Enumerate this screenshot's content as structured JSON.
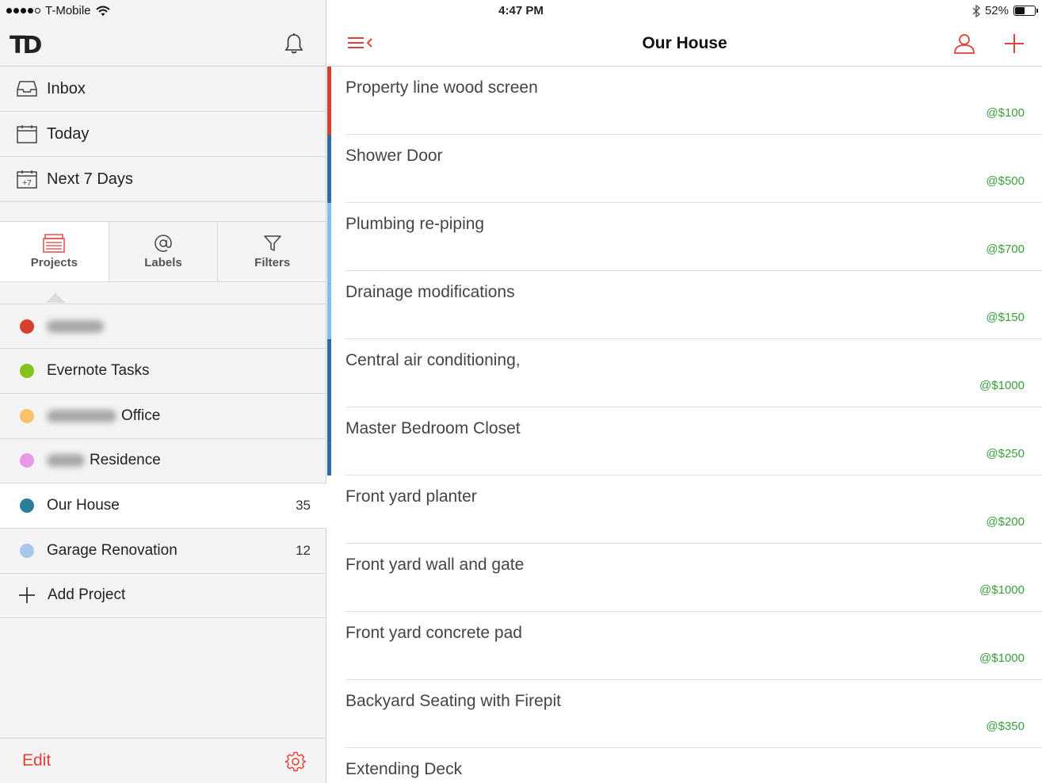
{
  "status_bar": {
    "carrier": "T-Mobile",
    "time": "4:47 PM",
    "battery": "52%",
    "battery_level": 0.52
  },
  "sidebar": {
    "logo": "TD",
    "nav": [
      {
        "label": "Inbox",
        "icon": "inbox-icon"
      },
      {
        "label": "Today",
        "icon": "calendar-icon"
      },
      {
        "label": "Next 7 Days",
        "icon": "calendar-plus7-icon",
        "icon_text": "+7"
      }
    ],
    "tabs": [
      {
        "label": "Projects",
        "icon": "projects-icon",
        "active": true
      },
      {
        "label": "Labels",
        "icon": "at-icon",
        "active": false
      },
      {
        "label": "Filters",
        "icon": "filter-icon",
        "active": false
      }
    ],
    "projects": [
      {
        "label": "",
        "color": "#d6402e",
        "count": "",
        "blurred": true
      },
      {
        "label": "Evernote Tasks",
        "color": "#84c31c",
        "count": ""
      },
      {
        "label": "Office",
        "color": "#fbc26e",
        "count": "",
        "blurred": true
      },
      {
        "label": "Residence",
        "color": "#e69ae6",
        "count": "",
        "blurred": true
      },
      {
        "label": "Our House",
        "color": "#2a7f97",
        "count": "35",
        "active": true
      },
      {
        "label": "Garage Renovation",
        "color": "#a9c7ea",
        "count": "12"
      }
    ],
    "add_project_label": "Add Project",
    "edit_label": "Edit"
  },
  "main": {
    "title": "Our House",
    "tasks": [
      {
        "name": "Property line wood screen",
        "label": "@$100",
        "color": "#d6402e"
      },
      {
        "name": "Shower Door",
        "label": "@$500",
        "color": "#2d6aa8"
      },
      {
        "name": "Plumbing re-piping",
        "label": "@$700",
        "color": "#82bff0"
      },
      {
        "name": "Drainage modifications",
        "label": "@$150",
        "color": "#82bff0"
      },
      {
        "name": "Central air conditioning,",
        "label": "@$1000",
        "color": "#2d6aa8"
      },
      {
        "name": "Master Bedroom Closet",
        "label": "@$250",
        "color": "#2d6aa8"
      },
      {
        "name": "Front yard planter",
        "label": "@$200",
        "color": ""
      },
      {
        "name": "Front yard wall and gate",
        "label": "@$1000",
        "color": ""
      },
      {
        "name": "Front yard concrete pad",
        "label": "@$1000",
        "color": ""
      },
      {
        "name": "Backyard Seating with Firepit",
        "label": "@$350",
        "color": ""
      },
      {
        "name": "Extending Deck",
        "label": "",
        "color": ""
      }
    ]
  },
  "colors": {
    "accent": "#e0423a",
    "label_green": "#3aa03a"
  }
}
